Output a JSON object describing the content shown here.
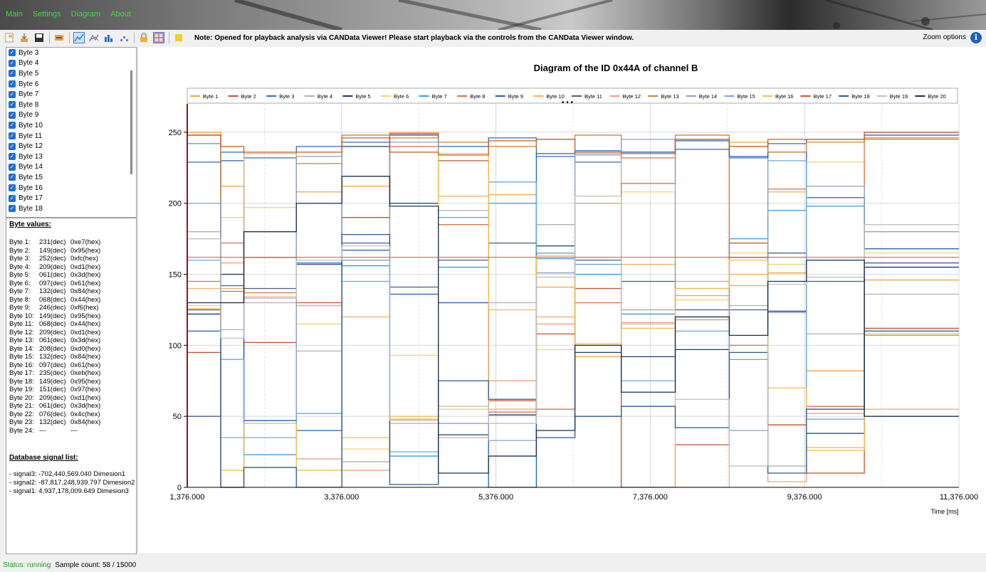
{
  "menu": [
    "Main",
    "Settings",
    "Diagram",
    "About"
  ],
  "toolbar": {
    "note": "Note: Opened for playback analysis via CANData Viewer! Please start playback via the controls from the CANData Viewer window.",
    "zoom_label": "Zoom options"
  },
  "byte_list": [
    "Byte 3",
    "Byte 4",
    "Byte 5",
    "Byte 6",
    "Byte 7",
    "Byte 8",
    "Byte 9",
    "Byte 10",
    "Byte 11",
    "Byte 12",
    "Byte 13",
    "Byte 14",
    "Byte 15",
    "Byte 16",
    "Byte 17",
    "Byte 18"
  ],
  "byte_values_title": "Byte values:",
  "byte_values": [
    [
      "Byte 1:",
      "231(dec)",
      "0xe7(hex)"
    ],
    [
      "Byte 2:",
      "149(dec)",
      "0x95(hex)"
    ],
    [
      "Byte 3:",
      "252(dec)",
      "0xfc(hex)"
    ],
    [
      "Byte 4:",
      "209(dec)",
      "0xd1(hex)"
    ],
    [
      "Byte 5:",
      "061(dec)",
      "0x3d(hex)"
    ],
    [
      "Byte 6:",
      "097(dec)",
      "0x61(hex)"
    ],
    [
      "Byte 7:",
      "132(dec)",
      "0x84(hex)"
    ],
    [
      "Byte 8:",
      "068(dec)",
      "0x44(hex)"
    ],
    [
      "Byte 9:",
      "246(dec)",
      "0xf6(hex)"
    ],
    [
      "Byte 10:",
      "149(dec)",
      "0x95(hex)"
    ],
    [
      "Byte 11:",
      "068(dec)",
      "0x44(hex)"
    ],
    [
      "Byte 12:",
      "209(dec)",
      "0xd1(hex)"
    ],
    [
      "Byte 13:",
      "061(dec)",
      "0x3d(hex)"
    ],
    [
      "Byte 14:",
      "208(dec)",
      "0xd0(hex)"
    ],
    [
      "Byte 15:",
      "132(dec)",
      "0x84(hex)"
    ],
    [
      "Byte 16:",
      "097(dec)",
      "0x61(hex)"
    ],
    [
      "Byte 17:",
      "235(dec)",
      "0xeb(hex)"
    ],
    [
      "Byte 18:",
      "149(dec)",
      "0x95(hex)"
    ],
    [
      "Byte 19:",
      "151(dec)",
      "0x97(hex)"
    ],
    [
      "Byte 20:",
      "209(dec)",
      "0xd1(hex)"
    ],
    [
      "Byte 21:",
      "061(dec)",
      "0x3d(hex)"
    ],
    [
      "Byte 22:",
      "076(dec)",
      "0x4c(hex)"
    ],
    [
      "Byte 23:",
      "132(dec)",
      "0x84(hex)"
    ],
    [
      "Byte 24:",
      "---",
      "---"
    ]
  ],
  "db_title": "Database signal list:",
  "db_signals": [
    "-  signal3: -702,440,569.040 Dimesion1",
    "-  signal2: -87,817,248,939.797 Dimesion2",
    "-  signal1: 4,937,178,009.649 Dimesion3"
  ],
  "chart_data": {
    "type": "line",
    "step": true,
    "title": "Diagram of the ID 0x44A of channel B",
    "xlabel": "Time [ms]",
    "ylabel": "",
    "xlim": [
      1376,
      11376
    ],
    "ylim": [
      0,
      270
    ],
    "xticks": [
      1376,
      3376,
      5376,
      7376,
      9376,
      11376
    ],
    "xtick_labels": [
      "1,376.000",
      "3,376.000",
      "5,376.000",
      "7,376.000",
      "9,376.000",
      "11,376.000"
    ],
    "yticks": [
      0,
      50,
      100,
      150,
      200,
      250
    ],
    "ytick_labels": [
      "0",
      "50",
      "100",
      "150",
      "200",
      "250"
    ],
    "hline": 162,
    "hline_color": "#ee4444",
    "grid": true,
    "legend_position": "top",
    "x": [
      1376,
      1810,
      2110,
      2790,
      3380,
      4000,
      4630,
      5280,
      5900,
      6400,
      7000,
      7700,
      8400,
      8900,
      9400,
      10150,
      11376
    ],
    "series": [
      {
        "name": "Byte 1",
        "color": "#f5a33a",
        "values": [
          250,
          212,
          162,
          208,
          212,
          250,
          130,
          206,
          141,
          92,
          125,
          135,
          243,
          151,
          82,
          146,
          137
        ]
      },
      {
        "name": "Byte 2",
        "color": "#c8502b",
        "values": [
          95,
          0,
          102,
          130,
          190,
          249,
          230,
          61,
          108,
          140,
          0,
          30,
          172,
          44,
          10,
          112,
          220
        ]
      },
      {
        "name": "Byte 3",
        "color": "#2d6cc8",
        "values": [
          229,
          236,
          232,
          240,
          243,
          248,
          240,
          246,
          233,
          229,
          236,
          238,
          232,
          242,
          245,
          248,
          244
        ]
      },
      {
        "name": "Byte 4",
        "color": "#b0b0b0",
        "values": [
          180,
          111,
          130,
          96,
          18,
          48,
          195,
          130,
          185,
          235,
          125,
          145,
          128,
          15,
          108,
          136,
          190
        ]
      },
      {
        "name": "Byte 5",
        "color": "#1d3f6b",
        "values": [
          122,
          150,
          162,
          158,
          240,
          200,
          37,
          51,
          170,
          95,
          92,
          97,
          162,
          124,
          38,
          155,
          100
        ]
      },
      {
        "name": "Byte 6",
        "color": "#f7d26b",
        "values": [
          128,
          190,
          197,
          115,
          27,
          93,
          55,
          75,
          97,
          100,
          208,
          132,
          165,
          157,
          229,
          165,
          8
        ]
      },
      {
        "name": "Byte 7",
        "color": "#3a9be0",
        "values": [
          242,
          138,
          23,
          158,
          156,
          22,
          155,
          200,
          161,
          150,
          122,
          118,
          175,
          195,
          198,
          168,
          95
        ]
      },
      {
        "name": "Byte 8",
        "color": "#e07048",
        "values": [
          145,
          172,
          137,
          128,
          160,
          240,
          185,
          53,
          55,
          130,
          214,
          245,
          100,
          210,
          57,
          245,
          140
        ]
      },
      {
        "name": "Byte 9",
        "color": "#2060b8",
        "values": [
          110,
          230,
          47,
          40,
          167,
          136,
          130,
          0,
          235,
          237,
          236,
          244,
          233,
          236,
          204,
          168,
          245
        ]
      },
      {
        "name": "Byte 10",
        "color": "#f5b060",
        "values": [
          140,
          140,
          235,
          128,
          120,
          48,
          205,
          55,
          120,
          200,
          157,
          0,
          150,
          208,
          28,
          55,
          48
        ]
      },
      {
        "name": "Byte 11",
        "color": "#4a5a8c",
        "values": [
          50,
          142,
          140,
          157,
          172,
          141,
          160,
          172,
          165,
          160,
          145,
          125,
          125,
          165,
          145,
          158,
          220
        ]
      },
      {
        "name": "Byte 12",
        "color": "#f0a080",
        "values": [
          175,
          158,
          134,
          20,
          12,
          45,
          35,
          75,
          115,
          200,
          116,
          118,
          142,
          4,
          52,
          110,
          145
        ]
      },
      {
        "name": "Byte 13",
        "color": "#d08030",
        "values": [
          248,
          130,
          162,
          228,
          248,
          246,
          243,
          240,
          245,
          248,
          232,
          248,
          240,
          236,
          243,
          246,
          250
        ]
      },
      {
        "name": "Byte 14",
        "color": "#8ca0c8",
        "values": [
          200,
          35,
          35,
          233,
          160,
          243,
          45,
          33,
          151,
          234,
          245,
          140,
          40,
          123,
          212,
          180,
          90
        ]
      },
      {
        "name": "Byte 15",
        "color": "#6aa8e8",
        "values": [
          160,
          90,
          23,
          52,
          145,
          25,
          190,
          215,
          165,
          157,
          75,
          110,
          90,
          230,
          48,
          107,
          130
        ]
      },
      {
        "name": "Byte 16",
        "color": "#f2c048",
        "values": [
          126,
          12,
          45,
          12,
          35,
          50,
          235,
          125,
          163,
          101,
          112,
          140,
          160,
          70,
          26,
          108,
          165
        ]
      },
      {
        "name": "Byte 17",
        "color": "#c85a1a",
        "values": [
          248,
          240,
          236,
          236,
          246,
          236,
          234,
          244,
          245,
          236,
          235,
          245,
          240,
          245,
          245,
          250,
          242
        ]
      },
      {
        "name": "Byte 18",
        "color": "#2a5a90",
        "values": [
          125,
          0,
          14,
          0,
          178,
          2,
          75,
          62,
          35,
          50,
          57,
          42,
          95,
          10,
          55,
          110,
          165
        ]
      },
      {
        "name": "Byte 19",
        "color": "#c0c0c0",
        "values": [
          175,
          105,
          133,
          160,
          170,
          47,
          57,
          45,
          148,
          205,
          115,
          62,
          15,
          143,
          148,
          185,
          190
        ]
      },
      {
        "name": "Byte 20",
        "color": "#1a3050",
        "values": [
          130,
          130,
          180,
          200,
          219,
          198,
          10,
          22,
          40,
          100,
          67,
          120,
          107,
          145,
          160,
          50,
          50
        ]
      }
    ]
  },
  "status": {
    "state": "Status: running",
    "count": "Sample count: 58 / 15000"
  }
}
